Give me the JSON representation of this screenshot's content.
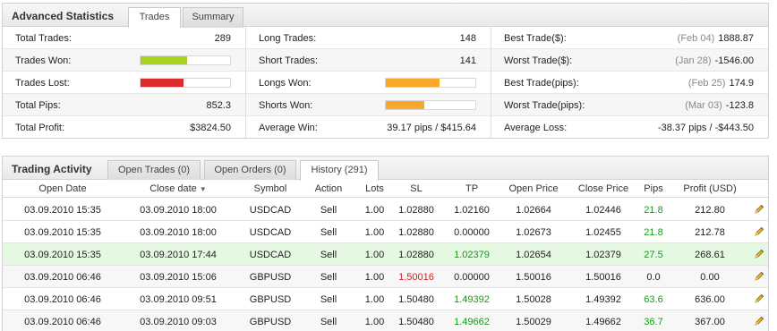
{
  "stats": {
    "title": "Advanced Statistics",
    "tabs": [
      "Trades",
      "Summary"
    ],
    "col1": [
      {
        "label": "Total Trades:",
        "value": "289"
      },
      {
        "label": "Trades Won:",
        "bar_pct": 0.52,
        "bar_color": "#a7d31e"
      },
      {
        "label": "Trades Lost:",
        "bar_pct": 0.48,
        "bar_color": "#dd2a2a"
      },
      {
        "label": "Total Pips:",
        "value": "852.3"
      },
      {
        "label": "Total Profit:",
        "value": "$3824.50"
      }
    ],
    "col2": [
      {
        "label": "Long Trades:",
        "value": "148"
      },
      {
        "label": "Short Trades:",
        "value": "141"
      },
      {
        "label": "Longs Won:",
        "bar_pct": 0.6,
        "bar_color": "#f8a92a"
      },
      {
        "label": "Shorts Won:",
        "bar_pct": 0.43,
        "bar_color": "#f8a92a"
      },
      {
        "label": "Average Win:",
        "value": "39.17 pips / $415.64"
      }
    ],
    "col3": [
      {
        "label": "Best Trade($):",
        "date": "(Feb 04)",
        "value": "1888.87"
      },
      {
        "label": "Worst Trade($):",
        "date": "(Jan 28)",
        "value": "-1546.00"
      },
      {
        "label": "Best Trade(pips):",
        "date": "(Feb 25)",
        "value": "174.9"
      },
      {
        "label": "Worst Trade(pips):",
        "date": "(Mar 03)",
        "value": "-123.8"
      },
      {
        "label": "Average Loss:",
        "value": "-38.37 pips / -$443.50"
      }
    ]
  },
  "activity": {
    "title": "Trading Activity",
    "tabs": [
      "Open Trades (0)",
      "Open Orders (0)",
      "History (291)"
    ],
    "columns": [
      "Open Date",
      "Close date",
      "Symbol",
      "Action",
      "Lots",
      "SL",
      "TP",
      "Open Price",
      "Close Price",
      "Pips",
      "Profit (USD)"
    ],
    "sort_indicator": "▼",
    "rows": [
      {
        "open": "03.09.2010 15:35",
        "close": "03.09.2010 18:00",
        "symbol": "USDCAD",
        "action": "Sell",
        "lots": "1.00",
        "sl": "1.02880",
        "tp": "1.02160",
        "open_price": "1.02664",
        "close_price": "1.02446",
        "pips": "21.8",
        "profit": "212.80"
      },
      {
        "open": "03.09.2010 15:35",
        "close": "03.09.2010 18:00",
        "symbol": "USDCAD",
        "action": "Sell",
        "lots": "1.00",
        "sl": "1.02880",
        "tp": "0.00000",
        "open_price": "1.02673",
        "close_price": "1.02455",
        "pips": "21.8",
        "profit": "212.78"
      },
      {
        "open": "03.09.2010 15:35",
        "close": "03.09.2010 17:44",
        "symbol": "USDCAD",
        "action": "Sell",
        "lots": "1.00",
        "sl": "1.02880",
        "tp": "1.02379",
        "open_price": "1.02654",
        "close_price": "1.02379",
        "pips": "27.5",
        "profit": "268.61"
      },
      {
        "open": "03.09.2010 06:46",
        "close": "03.09.2010 15:06",
        "symbol": "GBPUSD",
        "action": "Sell",
        "lots": "1.00",
        "sl": "1.50016",
        "tp": "0.00000",
        "open_price": "1.50016",
        "close_price": "1.50016",
        "pips": "0.0",
        "profit": "0.00"
      },
      {
        "open": "03.09.2010 06:46",
        "close": "03.09.2010 09:51",
        "symbol": "GBPUSD",
        "action": "Sell",
        "lots": "1.00",
        "sl": "1.50480",
        "tp": "1.49392",
        "open_price": "1.50028",
        "close_price": "1.49392",
        "pips": "63.6",
        "profit": "636.00"
      },
      {
        "open": "03.09.2010 06:46",
        "close": "03.09.2010 09:03",
        "symbol": "GBPUSD",
        "action": "Sell",
        "lots": "1.00",
        "sl": "1.50480",
        "tp": "1.49662",
        "open_price": "1.50029",
        "close_price": "1.49662",
        "pips": "36.7",
        "profit": "367.00"
      }
    ]
  }
}
